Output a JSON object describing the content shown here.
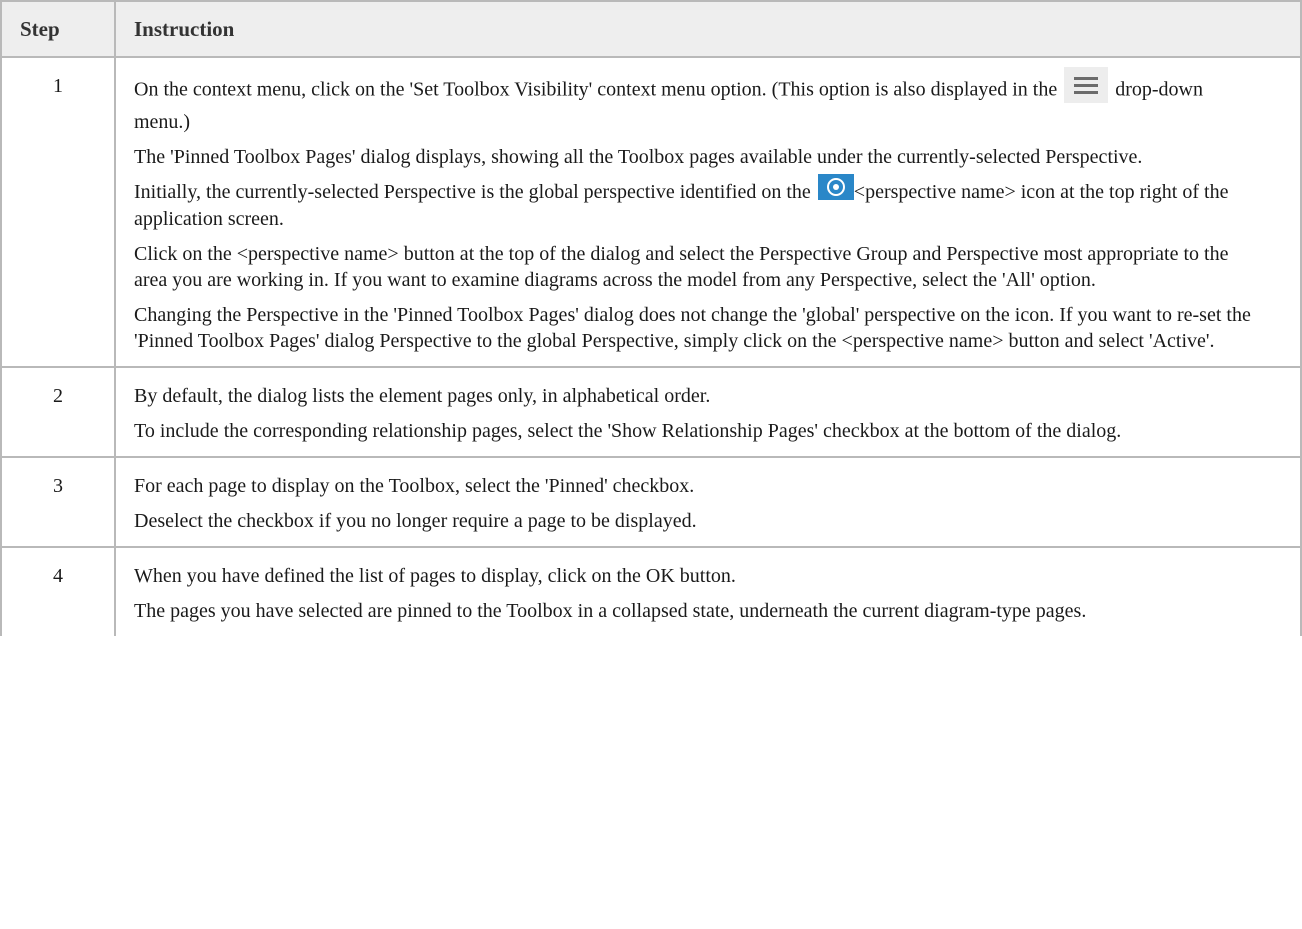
{
  "headers": {
    "step": "Step",
    "instruction": "Instruction"
  },
  "icons": {
    "menu": "hamburger-menu-icon",
    "perspective": "perspective-eye-icon",
    "perspective_color": "#2a87c8"
  },
  "rows": [
    {
      "step": "1",
      "p1_a": "On the context menu, click on the 'Set Toolbox Visibility' context menu option. (This option is also displayed in the",
      "p1_b": "drop-down menu.)",
      "p2": "The 'Pinned Toolbox Pages' dialog displays, showing all the Toolbox pages available under the currently-selected Perspective.",
      "p3_a": "Initially, the currently-selected Perspective is the global perspective identified on the",
      "p3_b": "<perspective name> icon at the top right of the application screen.",
      "p4": "Click on the <perspective name> button at the top of the dialog and select the Perspective Group and Perspective most appropriate to the area you are working in. If you want to examine diagrams across the model from any Perspective, select the 'All' option.",
      "p5": "Changing the Perspective in the 'Pinned Toolbox Pages' dialog does not change the 'global' perspective on the icon. If you want to re-set the 'Pinned Toolbox Pages' dialog Perspective to the global Perspective, simply click on the <perspective name> button and select 'Active'."
    },
    {
      "step": "2",
      "p1": "By default, the dialog lists the element pages only, in alphabetical order.",
      "p2": "To include the corresponding relationship pages, select the 'Show Relationship Pages' checkbox at the bottom of the dialog."
    },
    {
      "step": "3",
      "p1": "For each page to display on the Toolbox, select the 'Pinned' checkbox.",
      "p2": "Deselect the checkbox if you no longer require a page to be displayed."
    },
    {
      "step": "4",
      "p1": "When you have defined the list of pages to display, click on the OK button.",
      "p2": "The pages you have selected are pinned to the Toolbox in a collapsed state, underneath the current diagram-type pages."
    }
  ]
}
